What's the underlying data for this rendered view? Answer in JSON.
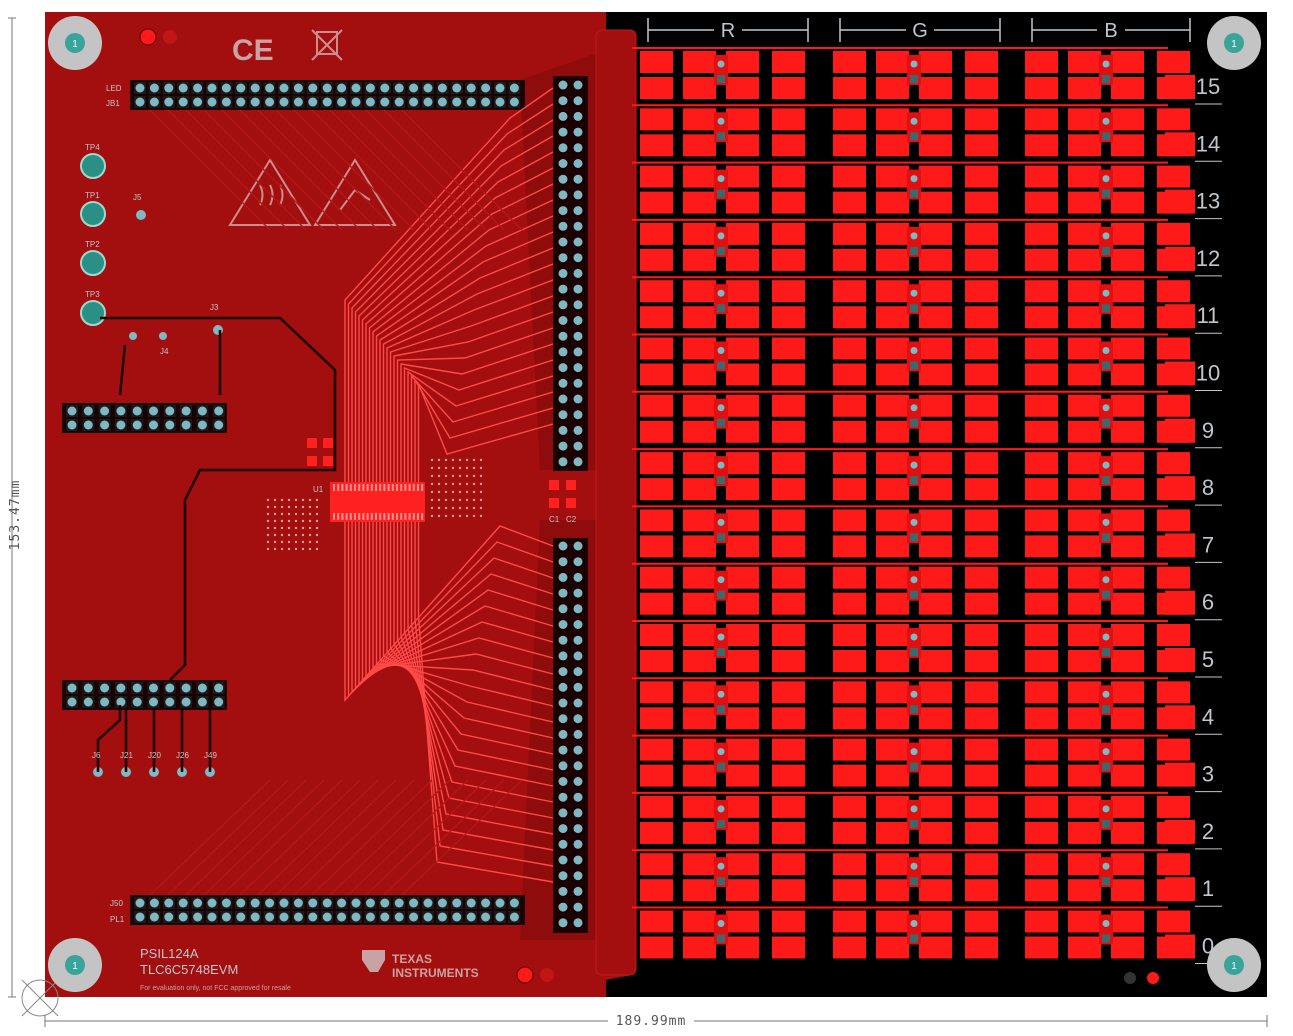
{
  "dimensions": {
    "width_label": "189.99",
    "width_unit": "mm",
    "height_label": "153.47",
    "height_unit": "mm"
  },
  "board": {
    "name": "PSIL124A",
    "model": "TLC6C5748EVM",
    "brand_line1": "TEXAS",
    "brand_line2": "INSTRUMENTS",
    "disclaimer": "For evaluation only, not FCC approved for resale",
    "ce_mark": "CE",
    "colors": {
      "pcb": "#a30e0e",
      "copper": "#ff1a1a",
      "trace": "#ff3030",
      "background_area": "#000000",
      "pad": "#7fb8c2",
      "mounting_hole": "#c4c4c4"
    }
  },
  "color_groups": [
    "R",
    "G",
    "B"
  ],
  "rows": [
    "15",
    "14",
    "13",
    "12",
    "11",
    "10",
    "9",
    "8",
    "7",
    "6",
    "5",
    "4",
    "3",
    "2",
    "1",
    "0"
  ],
  "mounting_holes": {
    "label": "1"
  },
  "test_points": [
    "TP4",
    "TP1",
    "TP2",
    "TP3"
  ],
  "connectors": {
    "top_left": [
      "LED",
      "JB1"
    ],
    "jumpers": [
      "J6",
      "J21",
      "J20",
      "J26",
      "J49"
    ],
    "caps": [
      "C1",
      "C2"
    ],
    "u1": "U1",
    "j3": "J3",
    "j4": "J4",
    "j5": "J5",
    "bottom_left": [
      "J50",
      "PL1"
    ]
  },
  "icons": [
    "esd-warning-icon",
    "hot-surface-icon",
    "weee-bin-icon",
    "ti-logo-icon"
  ]
}
